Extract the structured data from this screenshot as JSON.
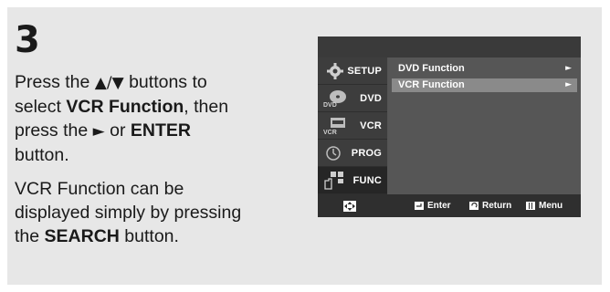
{
  "step": {
    "number": "3"
  },
  "instructions": {
    "line1_prefix": "Press the ",
    "line1_arrows": "▲/▼",
    "line1_suffix": " buttons to",
    "line2_prefix": "select ",
    "line2_bold": "VCR Function",
    "line2_suffix": ", then",
    "line3_prefix": "press the ",
    "line3_arrow": "►",
    "line3_mid": " or ",
    "line3_bold": "ENTER",
    "line4": "button.",
    "note_line1": "VCR Function can be",
    "note_line2": "displayed simply by pressing",
    "note_line3_prefix": "the ",
    "note_line3_bold": "SEARCH",
    "note_line3_suffix": " button."
  },
  "osd": {
    "sidebar": [
      {
        "label": "SETUP",
        "icon": "gear-icon"
      },
      {
        "label": "DVD",
        "icon": "dvd-disc-icon"
      },
      {
        "label": "VCR",
        "icon": "vcr-tape-icon"
      },
      {
        "label": "PROG",
        "icon": "clock-icon"
      },
      {
        "label": "FUNC",
        "icon": "function-hand-icon"
      }
    ],
    "menu": [
      {
        "label": "DVD Function",
        "arrow": "►"
      },
      {
        "label": "VCR Function",
        "arrow": "►"
      }
    ],
    "bottom": {
      "enter": "Enter",
      "return": "Return",
      "menu": "Menu"
    },
    "colors": {
      "highlight": "#8a8a8a",
      "panel": "#545454",
      "sidebar": "#3d3d3d"
    }
  }
}
